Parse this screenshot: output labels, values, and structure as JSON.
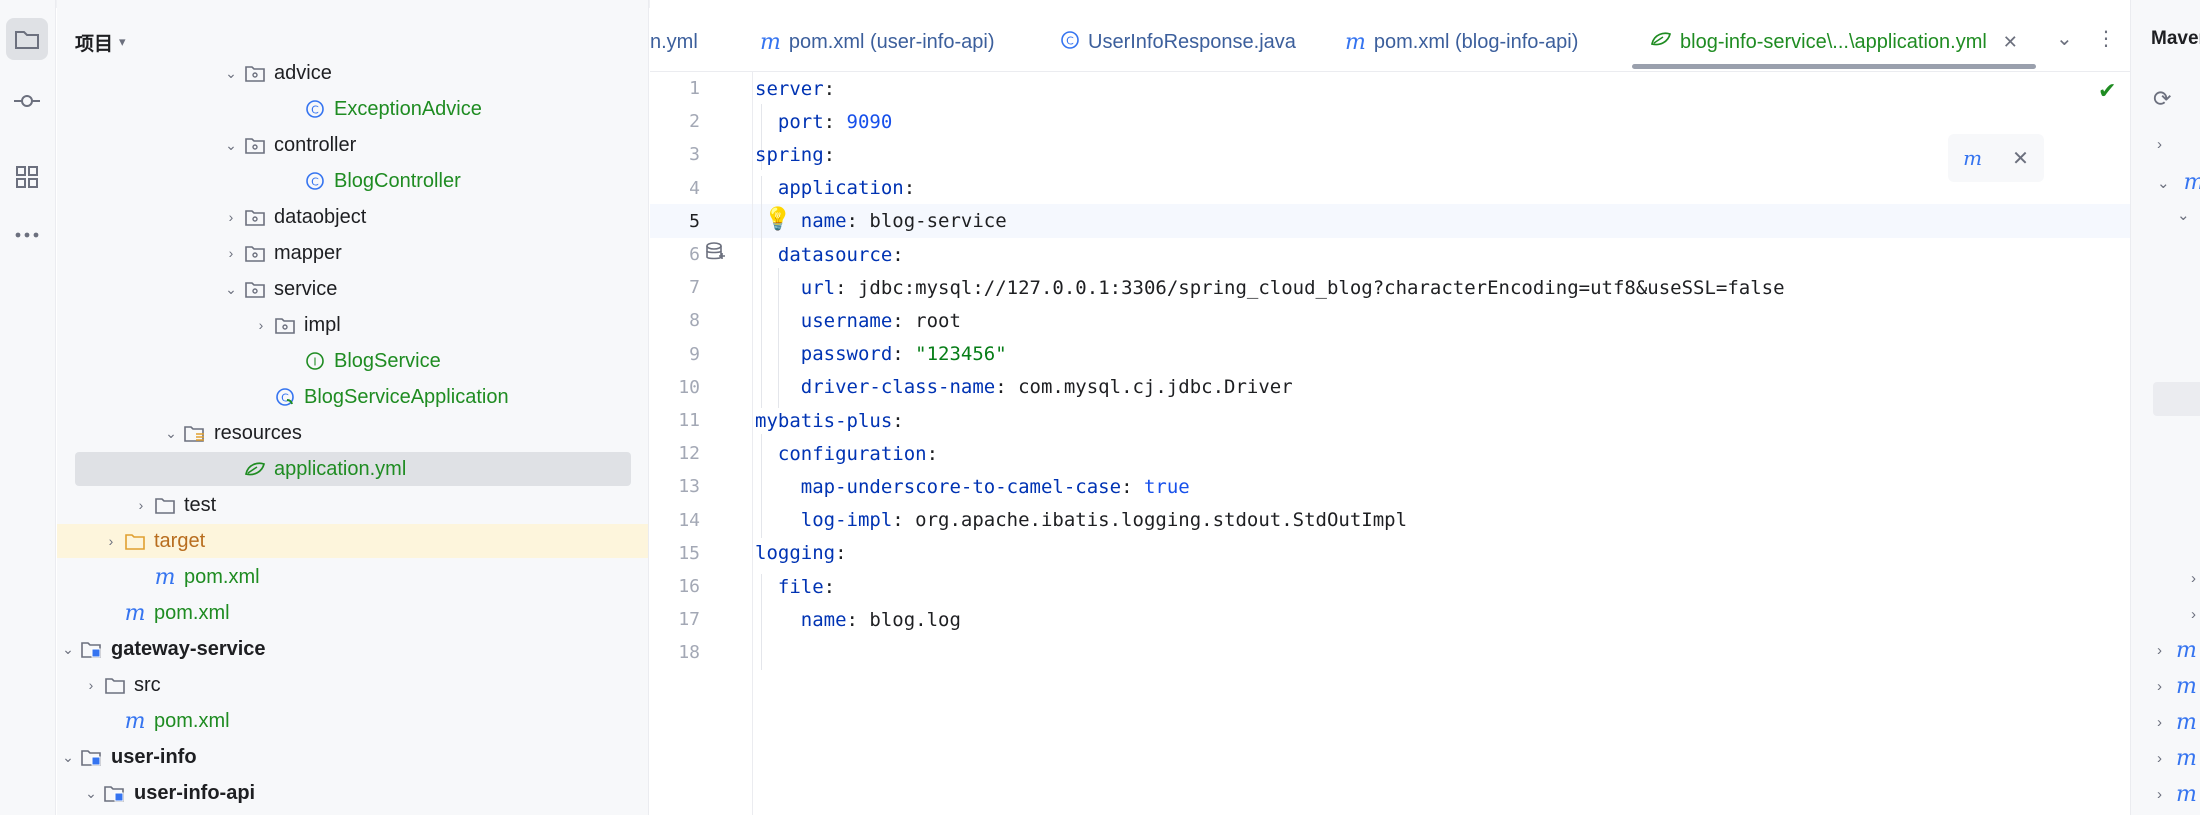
{
  "project_panel": {
    "title": "项目",
    "tree": [
      {
        "label": "advice",
        "kind": "package",
        "expanded": true,
        "color": "default"
      },
      {
        "label": "ExceptionAdvice",
        "kind": "class",
        "color": "green"
      },
      {
        "label": "controller",
        "kind": "package",
        "expanded": true,
        "color": "default"
      },
      {
        "label": "BlogController",
        "kind": "class",
        "color": "green"
      },
      {
        "label": "dataobject",
        "kind": "package",
        "expanded": false,
        "color": "default"
      },
      {
        "label": "mapper",
        "kind": "package",
        "expanded": false,
        "color": "default"
      },
      {
        "label": "service",
        "kind": "package",
        "expanded": true,
        "color": "default"
      },
      {
        "label": "impl",
        "kind": "package",
        "expanded": false,
        "color": "default"
      },
      {
        "label": "BlogService",
        "kind": "interface",
        "color": "green"
      },
      {
        "label": "BlogServiceApplication",
        "kind": "spring-class",
        "color": "green"
      },
      {
        "label": "resources",
        "kind": "resources-folder",
        "expanded": true,
        "color": "default"
      },
      {
        "label": "application.yml",
        "kind": "yaml",
        "color": "green",
        "selected": true
      },
      {
        "label": "test",
        "kind": "folder",
        "expanded": false,
        "color": "default"
      },
      {
        "label": "target",
        "kind": "excluded-folder",
        "expanded": false,
        "color": "orange"
      },
      {
        "label": "pom.xml",
        "kind": "maven",
        "color": "green"
      },
      {
        "label": "pom.xml",
        "kind": "maven",
        "color": "green"
      },
      {
        "label": "gateway-service",
        "kind": "module",
        "expanded": true,
        "color": "bold"
      },
      {
        "label": "src",
        "kind": "folder",
        "expanded": false,
        "color": "default"
      },
      {
        "label": "pom.xml",
        "kind": "maven",
        "color": "green"
      },
      {
        "label": "user-info",
        "kind": "module",
        "expanded": true,
        "color": "bold"
      },
      {
        "label": "user-info-api",
        "kind": "module",
        "expanded": true,
        "color": "bold"
      }
    ]
  },
  "tabs": [
    {
      "label": "n.yml",
      "icon": "none"
    },
    {
      "label": "pom.xml (user-info-api)",
      "icon": "maven-icon"
    },
    {
      "label": "UserInfoResponse.java",
      "icon": "class-icon"
    },
    {
      "label": "pom.xml (blog-info-api)",
      "icon": "maven-icon"
    },
    {
      "label": "blog-info-service\\...\\application.yml",
      "icon": "yaml-icon",
      "active": true
    }
  ],
  "editor": {
    "current_line": 5,
    "lines": [
      {
        "n": "1",
        "parts": [
          [
            "k",
            "server"
          ],
          [
            "p",
            ":"
          ]
        ]
      },
      {
        "n": "2",
        "parts": [
          [
            "s",
            "  "
          ],
          [
            "k",
            "port"
          ],
          [
            "p",
            ": "
          ],
          [
            "num",
            "9090"
          ]
        ]
      },
      {
        "n": "3",
        "parts": [
          [
            "k",
            "spring"
          ],
          [
            "p",
            ":"
          ]
        ]
      },
      {
        "n": "4",
        "parts": [
          [
            "s",
            "  "
          ],
          [
            "k",
            "application"
          ],
          [
            "p",
            ":"
          ]
        ]
      },
      {
        "n": "5",
        "parts": [
          [
            "s",
            "    "
          ],
          [
            "k",
            "name"
          ],
          [
            "p",
            ": blog-service"
          ]
        ]
      },
      {
        "n": "6",
        "parts": [
          [
            "s",
            "  "
          ],
          [
            "k",
            "datasource"
          ],
          [
            "p",
            ":"
          ]
        ]
      },
      {
        "n": "7",
        "parts": [
          [
            "s",
            "    "
          ],
          [
            "k",
            "url"
          ],
          [
            "p",
            ": jdbc:mysql://127.0.0.1:3306/spring_cloud_blog?characterEncoding=utf8&useSSL=false"
          ]
        ]
      },
      {
        "n": "8",
        "parts": [
          [
            "s",
            "    "
          ],
          [
            "k",
            "username"
          ],
          [
            "p",
            ": root"
          ]
        ]
      },
      {
        "n": "9",
        "parts": [
          [
            "s",
            "    "
          ],
          [
            "k",
            "password"
          ],
          [
            "p",
            ": "
          ],
          [
            "str",
            "\"123456\""
          ]
        ]
      },
      {
        "n": "10",
        "parts": [
          [
            "s",
            "    "
          ],
          [
            "k",
            "driver-class-name"
          ],
          [
            "p",
            ": com.mysql.cj.jdbc.Driver"
          ]
        ]
      },
      {
        "n": "11",
        "parts": [
          [
            "k",
            "mybatis-plus"
          ],
          [
            "p",
            ":"
          ]
        ]
      },
      {
        "n": "12",
        "parts": [
          [
            "s",
            "  "
          ],
          [
            "k",
            "configuration"
          ],
          [
            "p",
            ":"
          ]
        ]
      },
      {
        "n": "13",
        "parts": [
          [
            "s",
            "    "
          ],
          [
            "k",
            "map-underscore-to-camel-case"
          ],
          [
            "p",
            ": "
          ],
          [
            "num",
            "true"
          ]
        ]
      },
      {
        "n": "14",
        "parts": [
          [
            "s",
            "    "
          ],
          [
            "k",
            "log-impl"
          ],
          [
            "p",
            ": org.apache.ibatis.logging.stdout.StdOutImpl"
          ]
        ]
      },
      {
        "n": "15",
        "parts": [
          [
            "k",
            "logging"
          ],
          [
            "p",
            ":"
          ]
        ]
      },
      {
        "n": "16",
        "parts": [
          [
            "s",
            "  "
          ],
          [
            "k",
            "file"
          ],
          [
            "p",
            ":"
          ]
        ]
      },
      {
        "n": "17",
        "parts": [
          [
            "s",
            "    "
          ],
          [
            "k",
            "name"
          ],
          [
            "p",
            ": blog.log"
          ]
        ]
      },
      {
        "n": "18",
        "parts": []
      }
    ]
  },
  "maven_panel": {
    "title": "Maven"
  },
  "colors": {
    "key": "#0033b3",
    "number": "#1750eb",
    "string": "#067d17",
    "green_file": "#1f8c22",
    "excluded": "#b86d1f",
    "maven_blue": "#3574f0"
  }
}
